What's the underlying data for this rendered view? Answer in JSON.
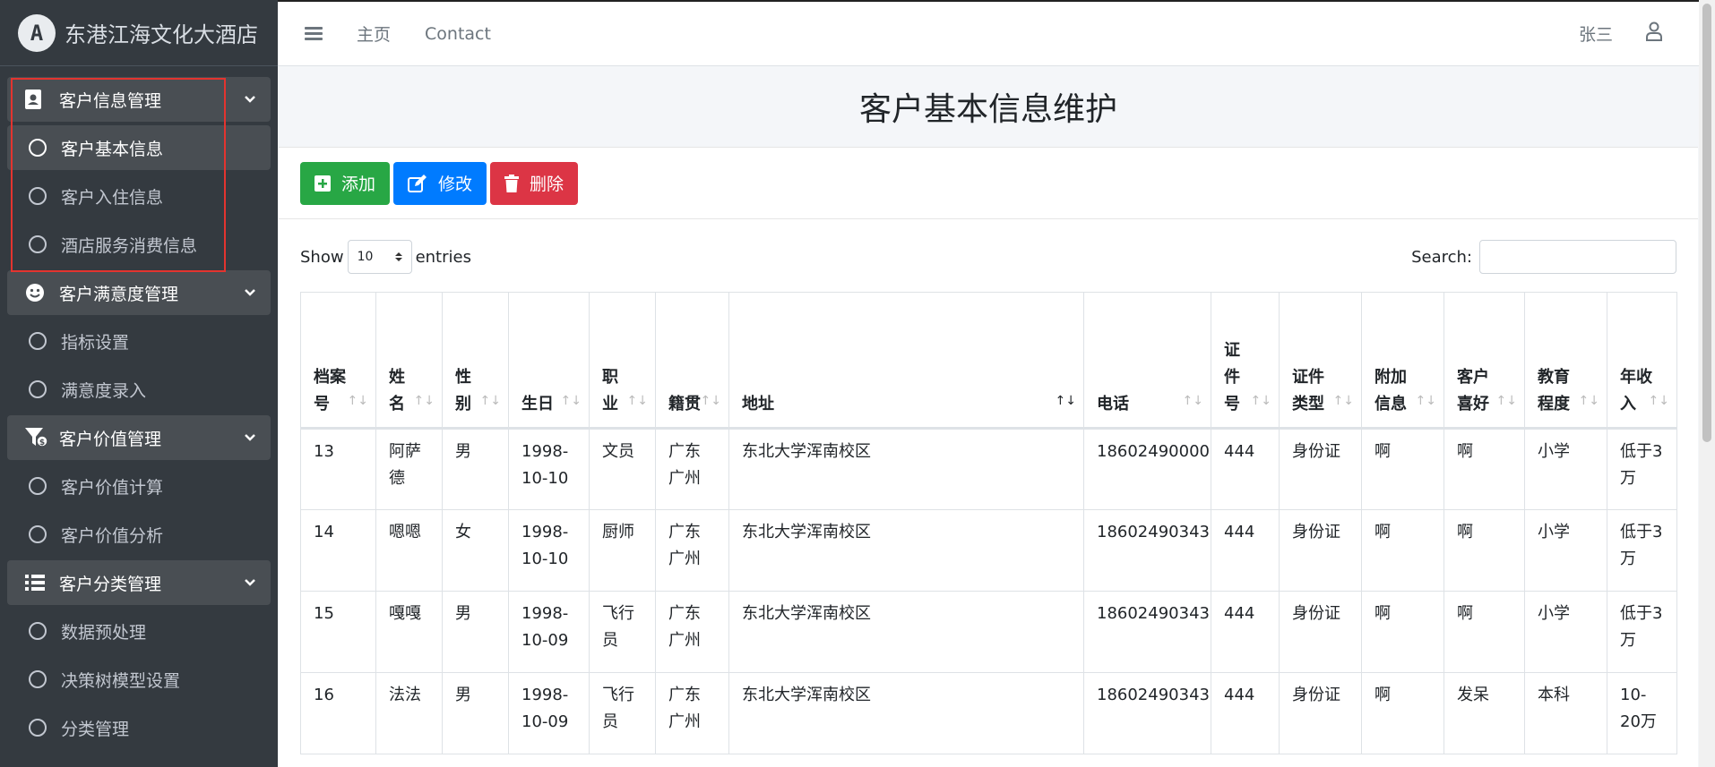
{
  "brand": {
    "logo_letter": "A",
    "name": "东港江海文化大酒店"
  },
  "sidebar": {
    "groups": [
      {
        "label": "客户信息管理",
        "icon": "id-card-icon",
        "items": [
          {
            "label": "客户基本信息",
            "active": true
          },
          {
            "label": "客户入住信息"
          },
          {
            "label": "酒店服务消费信息"
          }
        ]
      },
      {
        "label": "客户满意度管理",
        "icon": "smile-icon",
        "items": [
          {
            "label": "指标设置"
          },
          {
            "label": "满意度录入"
          }
        ]
      },
      {
        "label": "客户价值管理",
        "icon": "funnel-dollar-icon",
        "items": [
          {
            "label": "客户价值计算"
          },
          {
            "label": "客户价值分析"
          }
        ]
      },
      {
        "label": "客户分类管理",
        "icon": "list-icon",
        "items": [
          {
            "label": "数据预处理"
          },
          {
            "label": "决策树模型设置"
          },
          {
            "label": "分类管理"
          }
        ]
      }
    ]
  },
  "topbar": {
    "home": "主页",
    "contact": "Contact",
    "user": "张三"
  },
  "page": {
    "title": "客户基本信息维护"
  },
  "toolbar": {
    "add": "添加",
    "edit": "修改",
    "delete": "删除"
  },
  "datatable": {
    "show": "Show",
    "length": "10",
    "entries": "entries",
    "search_label": "Search:"
  },
  "table": {
    "columns": [
      "档案号",
      "姓名",
      "性别",
      "生日",
      "职业",
      "籍贯",
      "地址",
      "电话",
      "证件号",
      "证件类型",
      "附加信息",
      "客户喜好",
      "教育程度",
      "年收入"
    ],
    "rows": [
      [
        "13",
        "阿萨德",
        "男",
        "1998-10-10",
        "文员",
        "广东广州",
        "东北大学浑南校区",
        "18602490000",
        "444",
        "身份证",
        "啊",
        "啊",
        "小学",
        "低于3万"
      ],
      [
        "14",
        "嗯嗯",
        "女",
        "1998-10-10",
        "厨师",
        "广东广州",
        "东北大学浑南校区",
        "18602490343",
        "444",
        "身份证",
        "啊",
        "啊",
        "小学",
        "低于3万"
      ],
      [
        "15",
        "嘎嘎",
        "男",
        "1998-10-09",
        "飞行员",
        "广东广州",
        "东北大学浑南校区",
        "18602490343",
        "444",
        "身份证",
        "啊",
        "啊",
        "小学",
        "低于3万"
      ],
      [
        "16",
        "法法",
        "男",
        "1998-10-09",
        "飞行员",
        "广东广州",
        "东北大学浑南校区",
        "18602490343",
        "444",
        "身份证",
        "啊",
        "发呆",
        "本科",
        "10-20万"
      ]
    ]
  }
}
